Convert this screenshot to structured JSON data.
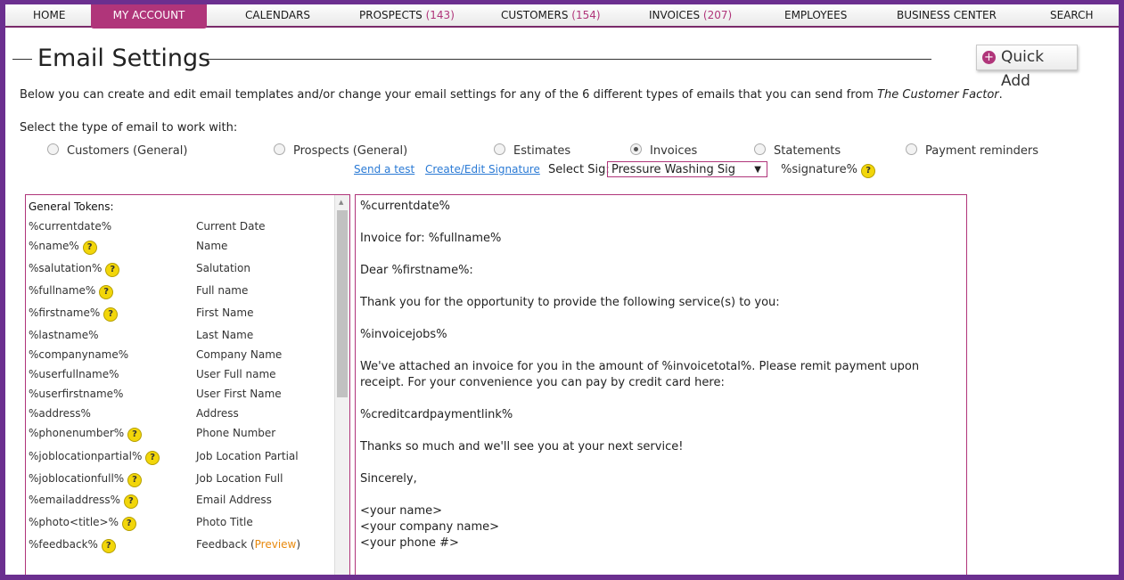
{
  "nav": {
    "items": [
      {
        "label": "HOME",
        "count": ""
      },
      {
        "label": "MY ACCOUNT",
        "count": ""
      },
      {
        "label": "CALENDARS",
        "count": ""
      },
      {
        "label": "PROSPECTS",
        "count": "(143)"
      },
      {
        "label": "CUSTOMERS",
        "count": "(154)"
      },
      {
        "label": "INVOICES",
        "count": "(207)"
      },
      {
        "label": "EMPLOYEES",
        "count": ""
      },
      {
        "label": "BUSINESS CENTER",
        "count": ""
      },
      {
        "label": "SEARCH",
        "count": ""
      }
    ],
    "active_index": 1
  },
  "page": {
    "title": "Email Settings",
    "quick_add": "Quick Add",
    "intro_text": "Below you can create and edit email templates and/or change your email settings for any of the 6 different types of emails that you can send from ",
    "intro_brand": "The Customer Factor",
    "intro_end": ".",
    "select_label": "Select the type of email to work with:"
  },
  "email_types": [
    {
      "label": "Customers (General)",
      "selected": false
    },
    {
      "label": "Prospects (General)",
      "selected": false
    },
    {
      "label": "Estimates",
      "selected": false
    },
    {
      "label": "Invoices",
      "selected": true
    },
    {
      "label": "Statements",
      "selected": false
    },
    {
      "label": "Payment reminders",
      "selected": false
    }
  ],
  "actions": {
    "send_test": "Send a test",
    "edit_signature": "Create/Edit Signature",
    "select_sig_label": "Select Sig:",
    "selected_sig": "Pressure Washing Sig",
    "signature_token": "%signature%"
  },
  "tokens": {
    "heading": "General Tokens:",
    "rows": [
      {
        "token": "%currentdate%",
        "desc": "Current Date",
        "help": false
      },
      {
        "token": "%name%",
        "desc": "Name",
        "help": true
      },
      {
        "token": "%salutation%",
        "desc": "Salutation",
        "help": true
      },
      {
        "token": "%fullname%",
        "desc": "Full name",
        "help": true
      },
      {
        "token": "%firstname%",
        "desc": "First Name",
        "help": true
      },
      {
        "token": "%lastname%",
        "desc": "Last Name",
        "help": false
      },
      {
        "token": "%companyname%",
        "desc": "Company Name",
        "help": false
      },
      {
        "token": "%userfullname%",
        "desc": "User Full name",
        "help": false
      },
      {
        "token": "%userfirstname%",
        "desc": "User First Name",
        "help": false
      },
      {
        "token": "%address%",
        "desc": "Address",
        "help": false
      },
      {
        "token": "%phonenumber%",
        "desc": "Phone Number",
        "help": true
      },
      {
        "token": "%joblocationpartial%",
        "desc": "Job Location Partial",
        "help": true
      },
      {
        "token": "%joblocationfull%",
        "desc": "Job Location Full",
        "help": true
      },
      {
        "token": "%emailaddress%",
        "desc": "Email Address",
        "help": true
      },
      {
        "token": "%photo<title>%",
        "desc": "Photo Title",
        "help": true
      },
      {
        "token": "%feedback%",
        "desc": "Feedback (",
        "help": true,
        "preview": "Preview",
        "desc_end": ")"
      }
    ]
  },
  "template_body": [
    "%currentdate%",
    "",
    "Invoice for: %fullname%",
    "",
    "Dear %firstname%:",
    "",
    "Thank you for the opportunity to provide the following service(s) to you:",
    "",
    "%invoicejobs%",
    "",
    "We've attached an invoice for you in the amount of %invoicetotal%. Please remit payment upon receipt. For your convenience you can pay by credit card here:",
    "",
    "%creditcardpaymentlink%",
    "",
    "Thanks so much and we'll see you at your next service!",
    "",
    "Sincerely,",
    "",
    "<your name>",
    "<your company name>",
    "<your phone #>"
  ],
  "colors": {
    "accent": "#b0357a",
    "frame": "#6b2f8f",
    "link": "#2a7ad5",
    "help": "#f2d60a",
    "preview": "#e8890d"
  }
}
